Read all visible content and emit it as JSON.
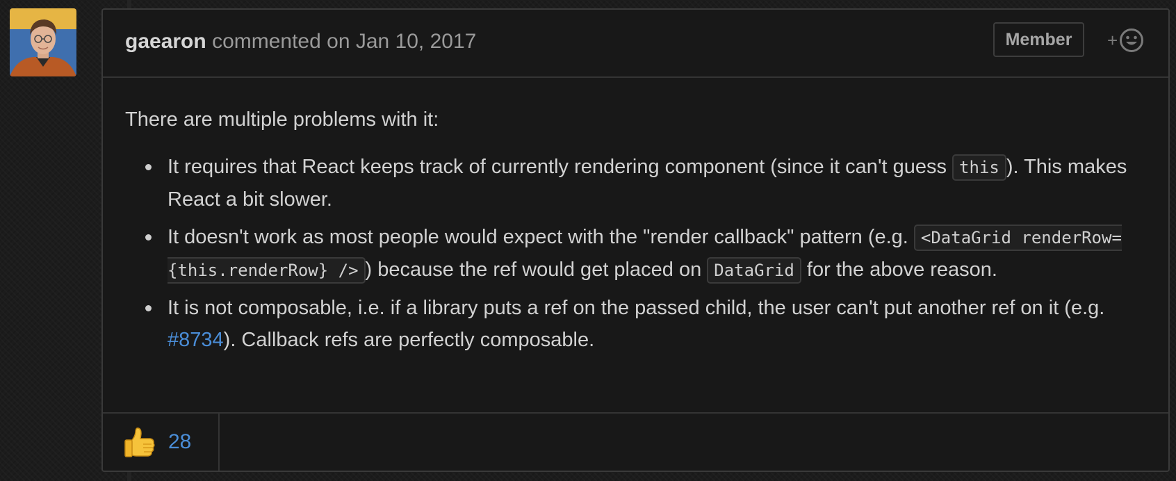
{
  "comment": {
    "author": "gaearon",
    "action": "commented on Jan 10, 2017",
    "badge": "Member",
    "intro": "There are multiple problems with it:",
    "bullets": {
      "b1_part1": "It requires that React keeps track of currently rendering component (since it can't guess ",
      "b1_code": "this",
      "b1_part2": "). This makes React a bit slower.",
      "b2_part1": "It doesn't work as most people would expect with the \"render callback\" pattern (e.g. ",
      "b2_code1": "<DataGrid renderRow={this.renderRow} />",
      "b2_part2": ") because the ref would get placed on ",
      "b2_code2": "DataGrid",
      "b2_part3": " for the above reason.",
      "b3_part1": "It is not composable, i.e. if a library puts a ref on the passed child, the user can't put another ref on it (e.g. ",
      "b3_link": "#8734",
      "b3_part2": "). Callback refs are perfectly composable."
    },
    "reactions": {
      "thumbs_up_count": "28",
      "add_plus": "+"
    }
  },
  "colors": {
    "background": "#1c1c1c",
    "card": "#181818",
    "border": "#3a3a3a",
    "link": "#4a8dd7",
    "text": "#d2d2d2"
  },
  "icons": [
    "avatar",
    "smiley-icon",
    "thumbs-up-icon"
  ]
}
